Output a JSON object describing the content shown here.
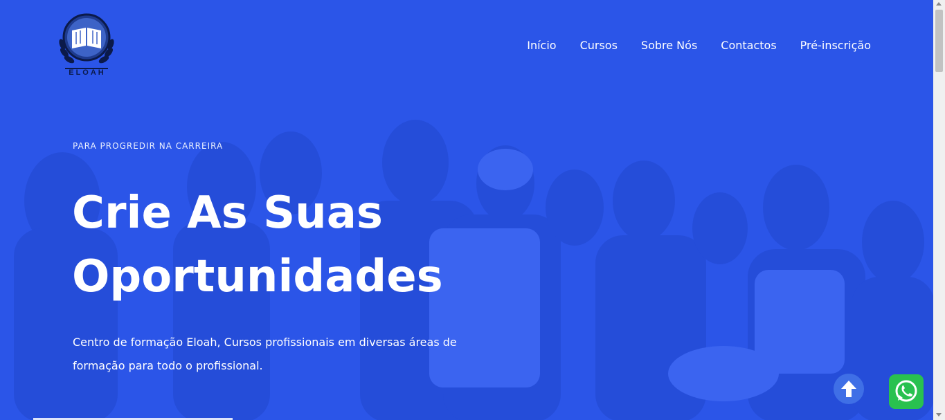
{
  "brand": {
    "logo_name": "ELOAH",
    "logo_icon": "open-book-laurel-logo"
  },
  "nav": {
    "items": [
      {
        "label": "Início"
      },
      {
        "label": "Cursos"
      },
      {
        "label": "Sobre Nós"
      },
      {
        "label": "Contactos"
      },
      {
        "label": "Pré-inscrição"
      }
    ]
  },
  "hero": {
    "subtitle": "PARA PROGREDIR NA CARREIRA",
    "headline_line1": "Crie As Suas",
    "headline_line2": "Oportunidades",
    "description": "Centro de formação Eloah, Cursos profissionais em diversas áreas de formação para todo o profissional."
  },
  "widgets": {
    "scroll_top_icon": "arrow-up-icon",
    "whatsapp_icon": "whatsapp-icon"
  },
  "colors": {
    "hero_overlay": "#2b55e8",
    "nav_text": "#ffffff",
    "whatsapp_green": "#29c14f"
  }
}
